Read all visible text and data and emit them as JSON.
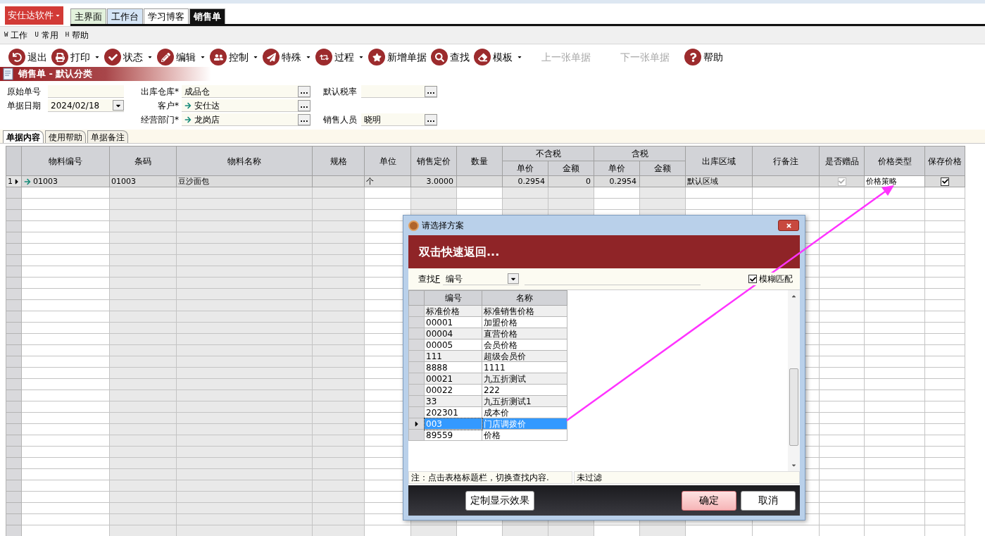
{
  "app_menu": {
    "label": "安仕达软件"
  },
  "tabs": [
    {
      "label": "主界面",
      "color": "#e2f1dc",
      "selected": false
    },
    {
      "label": "工作台",
      "color": "#d5e5f6",
      "selected": false
    },
    {
      "label": "学习博客",
      "color": "#ffffff",
      "selected": false
    },
    {
      "label": "销售单",
      "color": "#111111",
      "selected": true
    }
  ],
  "menu": [
    {
      "key": "W",
      "label": "工作"
    },
    {
      "key": "U",
      "label": "常用"
    },
    {
      "key": "H",
      "label": "帮助"
    }
  ],
  "toolbar": [
    {
      "label": "退出",
      "dropdown": false,
      "disabled": false
    },
    {
      "label": "打印",
      "dropdown": true,
      "disabled": false
    },
    {
      "label": "状态",
      "dropdown": true,
      "disabled": false
    },
    {
      "label": "编辑",
      "dropdown": true,
      "disabled": false
    },
    {
      "label": "控制",
      "dropdown": true,
      "disabled": false
    },
    {
      "label": "特殊",
      "dropdown": true,
      "disabled": false
    },
    {
      "label": "过程",
      "dropdown": true,
      "disabled": false
    },
    {
      "label": "新增单据",
      "dropdown": false,
      "disabled": false
    },
    {
      "label": "查找",
      "dropdown": false,
      "disabled": false
    },
    {
      "label": "模板",
      "dropdown": true,
      "disabled": false
    },
    {
      "label": "上一张单据",
      "dropdown": false,
      "disabled": true
    },
    {
      "label": "下一张单据",
      "dropdown": false,
      "disabled": true
    },
    {
      "label": "帮助",
      "dropdown": false,
      "disabled": false
    }
  ],
  "doc_title": "销售单 - 默认分类",
  "form": {
    "columns": [
      [
        {
          "label": "原始单号",
          "kind": "text"
        },
        {
          "label": "单据日期",
          "kind": "date",
          "value": "2024/02/18"
        }
      ],
      [
        {
          "label": "出库仓库*",
          "kind": "lookup",
          "value": "成品仓",
          "button": "..."
        },
        {
          "label": "客户*",
          "kind": "lookup",
          "value": "安仕达",
          "linked": true,
          "button": "..."
        },
        {
          "label": "经营部门*",
          "kind": "lookup",
          "value": "龙岗店",
          "linked": true,
          "button": "..."
        }
      ],
      [
        {
          "label": "默认税率",
          "kind": "lookup",
          "button": "..."
        },
        {
          "label": "销售人员",
          "kind": "lookup",
          "value": "晓明",
          "button": "..."
        }
      ]
    ]
  },
  "sheet_tabs": [
    {
      "label": "单据内容",
      "selected": true
    },
    {
      "label": "使用帮助",
      "selected": false
    },
    {
      "label": "单据备注",
      "selected": false
    }
  ],
  "grid": {
    "columns": [
      {
        "label": "物料编号",
        "kind": "text"
      },
      {
        "label": "条码",
        "kind": "text",
        "readonly": true
      },
      {
        "label": "物料名称",
        "kind": "text",
        "readonly": true
      },
      {
        "label": "规格",
        "kind": "text",
        "readonly": true
      },
      {
        "label": "单位",
        "kind": "text"
      },
      {
        "label": "销售定价",
        "kind": "number",
        "readonly": true
      },
      {
        "label": "数量",
        "kind": "number"
      },
      {
        "label": "不含税",
        "colspan": 2,
        "children": [
          {
            "label": "单价",
            "kind": "number",
            "readonly": true
          },
          {
            "label": "金额",
            "kind": "number",
            "readonly": true
          }
        ]
      },
      {
        "label": "含税",
        "colspan": 2,
        "children": [
          {
            "label": "单价",
            "kind": "number"
          },
          {
            "label": "金额",
            "kind": "number",
            "readonly": true
          }
        ]
      },
      {
        "label": "出库区域",
        "kind": "text"
      },
      {
        "label": "行备注",
        "kind": "text"
      },
      {
        "label": "是否赠品",
        "kind": "check"
      },
      {
        "label": "价格类型",
        "kind": "text"
      },
      {
        "label": "保存价格",
        "kind": "check"
      }
    ],
    "rows": [
      {
        "number": "1",
        "current": true,
        "cells": [
          {
            "text": "01003",
            "lookup": true
          },
          {
            "text": "01003"
          },
          {
            "text": "豆沙面包"
          },
          {},
          {
            "text": "个"
          },
          {
            "text": "3.0000"
          },
          {},
          {
            "text": "0.2954"
          },
          {
            "text": "0"
          },
          {
            "text": "0.2954"
          },
          {},
          {
            "text": "默认区域"
          },
          {},
          {
            "checked": true,
            "disabled": true
          },
          {
            "text": "价格策略",
            "editing": true
          },
          {
            "checked": true,
            "disabled": false
          }
        ]
      }
    ]
  },
  "dialog": {
    "title": "请选择方案",
    "banner": "双击快速返回...",
    "search_label": "查找",
    "search_key": "F",
    "search_by": "编号",
    "fuzzy": {
      "label": "模糊匹配",
      "checked": true
    },
    "columns": [
      "编号",
      "名称"
    ],
    "rows": [
      {
        "code": "标准价格",
        "name": "标准销售价格",
        "selected": false
      },
      {
        "code": "00001",
        "name": "加盟价格",
        "selected": false
      },
      {
        "code": "00004",
        "name": "直营价格",
        "selected": false
      },
      {
        "code": "00005",
        "name": "会员价格",
        "selected": false
      },
      {
        "code": "111",
        "name": "超级会员价",
        "selected": false
      },
      {
        "code": "8888",
        "name": "1111",
        "selected": false
      },
      {
        "code": "00021",
        "name": "九五折测试",
        "selected": false
      },
      {
        "code": "00022",
        "name": "222",
        "selected": false
      },
      {
        "code": "33",
        "name": "九五折测试1",
        "selected": false
      },
      {
        "code": "202301",
        "name": "成本价",
        "selected": false
      },
      {
        "code": "003",
        "name": "门店调拨价",
        "selected": true
      },
      {
        "code": "89559",
        "name": "价格",
        "selected": false
      }
    ],
    "hint": "注：点击表格标题栏，切换查找内容.",
    "filter_status": "未过滤",
    "buttons": [
      {
        "label": "定制显示效果",
        "kind": "option"
      },
      {
        "label": "确定",
        "kind": "primary"
      },
      {
        "label": "取消",
        "kind": "cancel"
      }
    ]
  }
}
